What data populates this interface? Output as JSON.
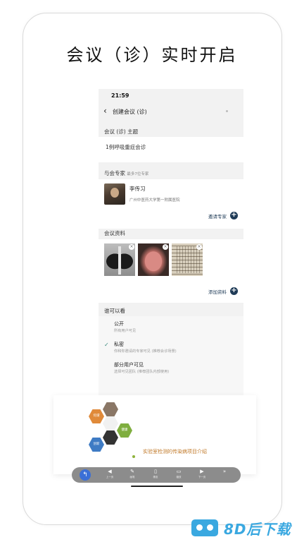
{
  "headline": "会议（诊）实时开启",
  "phone": {
    "status_time": "21:59",
    "nav": {
      "back_icon": "‹",
      "title": "创建会议 (诊)"
    },
    "topic": {
      "label": "会议 (诊) 主题",
      "value": "1例呼吸重症会诊"
    },
    "experts": {
      "label": "与会专家",
      "hint": "最多7位专家",
      "items": [
        {
          "name": "李传习",
          "org": "广州中医药大学第一附属医院"
        }
      ],
      "invite_label": "邀请专家"
    },
    "materials": {
      "label": "会议资料",
      "add_label": "添加资料",
      "images": [
        "chest-xray",
        "tongue-photo",
        "handwritten-note"
      ]
    },
    "visibility": {
      "label": "谁可以看",
      "options": [
        {
          "title": "公开",
          "sub": "所有用户可见",
          "selected": false
        },
        {
          "title": "私密",
          "sub": "你和你邀请的专家可见 (推荐会诊场景)",
          "selected": true
        },
        {
          "title": "部分用户可见",
          "sub": "选择可见团队 (推荐团队内部使用)",
          "selected": false
        }
      ]
    }
  },
  "slide": {
    "hex_labels": [
      "何谓",
      "健康",
      "创新"
    ],
    "title": "实验室检测的传染病项目介绍"
  },
  "toolbar": {
    "items": [
      {
        "icon": "prev-icon",
        "glyph": "◀",
        "label": "上一页"
      },
      {
        "icon": "pen-icon",
        "glyph": "✎",
        "label": "画笔"
      },
      {
        "icon": "eraser-icon",
        "glyph": "▯",
        "label": "橡皮"
      },
      {
        "icon": "fullscreen-icon",
        "glyph": "▭",
        "label": "缩放"
      },
      {
        "icon": "next-icon",
        "glyph": "▶",
        "label": "下一页"
      },
      {
        "icon": "more-icon",
        "glyph": "»",
        "label": ""
      }
    ]
  },
  "watermark": {
    "text": "8D后下载"
  },
  "colors": {
    "accent": "#1f3b57",
    "check": "#3a8a7c",
    "watermark": "#3aa8e0"
  }
}
